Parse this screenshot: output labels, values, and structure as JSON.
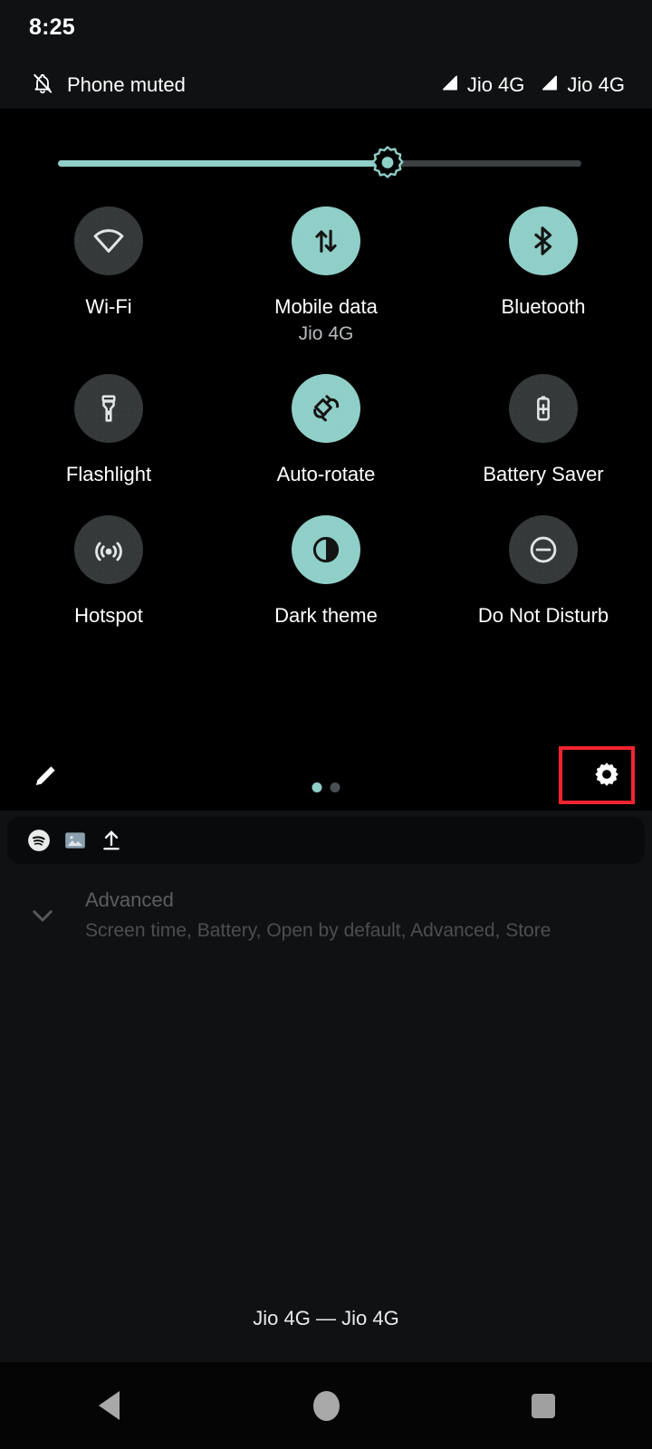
{
  "statusbar": {
    "clock": "8:25",
    "muted_label": "Phone muted",
    "muted_icon": "bell-off-icon",
    "signals": [
      {
        "icon": "signal-bar-icon",
        "label": "Jio 4G"
      },
      {
        "icon": "signal-bar-icon",
        "label": "Jio 4G"
      }
    ]
  },
  "brightness": {
    "name": "brightness-slider",
    "icon": "brightness-sun-icon",
    "percent": 63,
    "fill_color": "#8fcfc8",
    "track_color": "#3b4042"
  },
  "quick_settings": {
    "tiles": [
      {
        "label": "Wi-Fi",
        "sub": "",
        "icon": "wifi-off-icon",
        "state": "off"
      },
      {
        "label": "Mobile data",
        "sub": "Jio 4G",
        "icon": "mobile-data-icon",
        "state": "on"
      },
      {
        "label": "Bluetooth",
        "sub": "",
        "icon": "bluetooth-icon",
        "state": "on"
      },
      {
        "label": "Flashlight",
        "sub": "",
        "icon": "flashlight-icon",
        "state": "off"
      },
      {
        "label": "Auto-rotate",
        "sub": "",
        "icon": "auto-rotate-icon",
        "state": "on"
      },
      {
        "label": "Battery Saver",
        "sub": "",
        "icon": "battery-saver-icon",
        "state": "off"
      },
      {
        "label": "Hotspot",
        "sub": "",
        "icon": "hotspot-icon",
        "state": "off"
      },
      {
        "label": "Dark theme",
        "sub": "",
        "icon": "dark-theme-icon",
        "state": "on"
      },
      {
        "label": "Do Not Disturb",
        "sub": "",
        "icon": "do-not-disturb-icon",
        "state": "off"
      }
    ],
    "footer": {
      "edit_icon": "pencil-edit-icon",
      "settings_icon": "gear-icon",
      "pages": 2,
      "active_page": 1
    }
  },
  "highlight": {
    "name": "settings-gear-highlight",
    "color": "#f3232f",
    "target": "gear-icon"
  },
  "notification_strip": {
    "icons": [
      "spotify-icon",
      "image-icon",
      "upload-icon"
    ]
  },
  "background_page": {
    "advanced": {
      "title": "Advanced",
      "subtitle": "Screen time, Battery, Open by default, Advanced, Store",
      "chevron_icon": "chevron-down-icon"
    }
  },
  "bottom": {
    "carrier": "Jio 4G — Jio 4G",
    "nav": {
      "back_icon": "back-triangle-icon",
      "home_icon": "home-circle-icon",
      "recents_icon": "recents-square-icon"
    }
  }
}
